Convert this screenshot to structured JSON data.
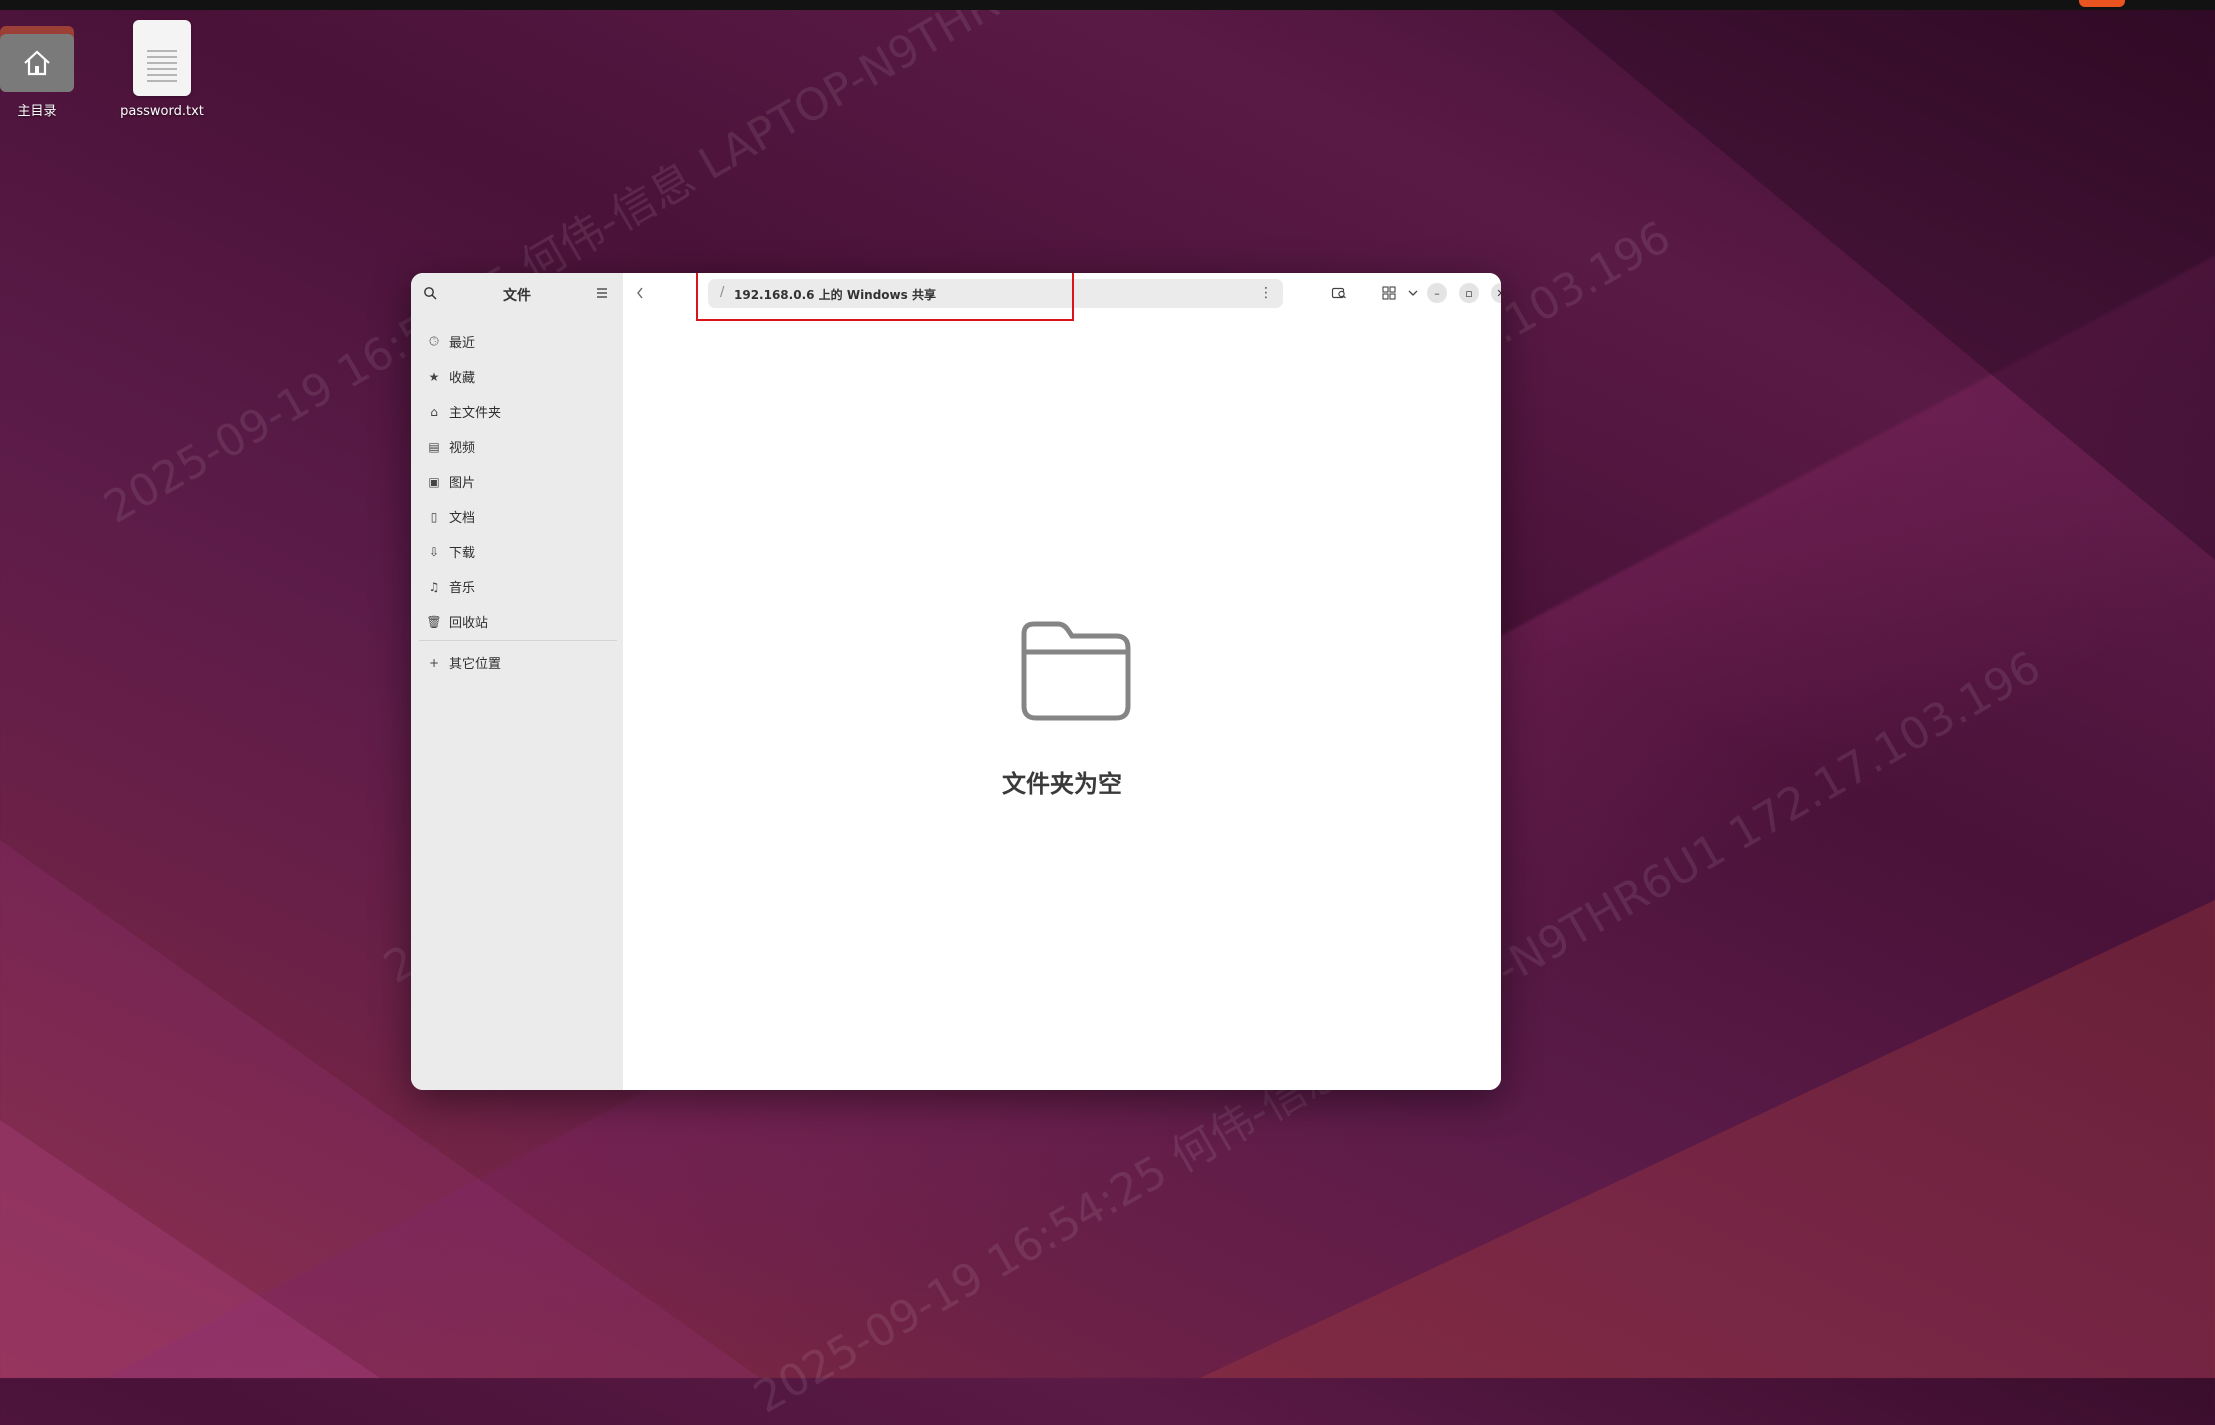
{
  "desktop": {
    "icons": [
      {
        "label": "主目录"
      },
      {
        "label": "password.txt"
      }
    ]
  },
  "window": {
    "sidebar": {
      "title": "文件",
      "items": [
        {
          "label": "最近",
          "icon": "clock-icon"
        },
        {
          "label": "收藏",
          "icon": "star-icon"
        },
        {
          "label": "主文件夹",
          "icon": "home-icon"
        },
        {
          "label": "视频",
          "icon": "film-icon"
        },
        {
          "label": "图片",
          "icon": "image-icon"
        },
        {
          "label": "文档",
          "icon": "document-icon"
        },
        {
          "label": "下载",
          "icon": "download-icon"
        },
        {
          "label": "音乐",
          "icon": "music-icon"
        },
        {
          "label": "回收站",
          "icon": "trash-icon"
        }
      ],
      "other_locations": {
        "label": "其它位置",
        "icon": "plus-icon"
      }
    },
    "pathbar": {
      "separator": "/",
      "path": "192.168.0.6 上的 Windows 共享"
    },
    "main": {
      "empty_text": "文件夹为空"
    }
  },
  "colors": {
    "highlight": "#d9141b",
    "accent": "#e95420"
  }
}
